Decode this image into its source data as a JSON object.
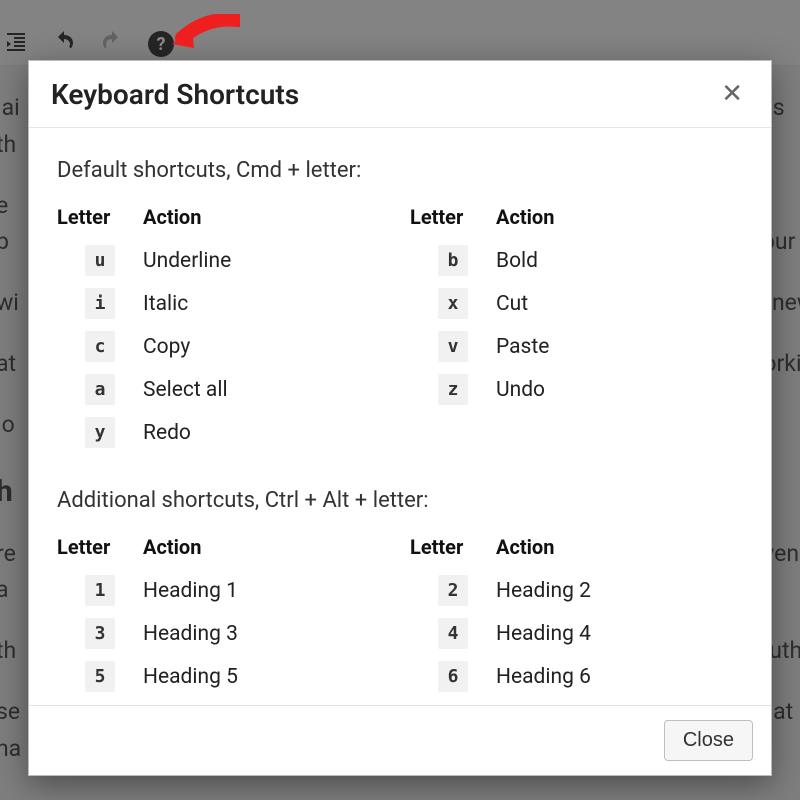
{
  "modal": {
    "title": "Keyboard Shortcuts",
    "close_button": "Close"
  },
  "section1": {
    "heading": "Default shortcuts, Cmd + letter:",
    "header_letter": "Letter",
    "header_action": "Action",
    "left": [
      {
        "key": "u",
        "action": "Underline"
      },
      {
        "key": "i",
        "action": "Italic"
      },
      {
        "key": "c",
        "action": "Copy"
      },
      {
        "key": "a",
        "action": "Select all"
      },
      {
        "key": "y",
        "action": "Redo"
      }
    ],
    "right": [
      {
        "key": "b",
        "action": "Bold"
      },
      {
        "key": "x",
        "action": "Cut"
      },
      {
        "key": "v",
        "action": "Paste"
      },
      {
        "key": "z",
        "action": "Undo"
      }
    ]
  },
  "section2": {
    "heading": "Additional shortcuts, Ctrl + Alt + letter:",
    "header_letter": "Letter",
    "header_action": "Action",
    "left": [
      {
        "key": "1",
        "action": "Heading 1"
      },
      {
        "key": "3",
        "action": "Heading 3"
      },
      {
        "key": "5",
        "action": "Heading 5"
      }
    ],
    "right": [
      {
        "key": "2",
        "action": "Heading 2"
      },
      {
        "key": "4",
        "action": "Heading 4"
      },
      {
        "key": "6",
        "action": "Heading 6"
      }
    ]
  }
}
